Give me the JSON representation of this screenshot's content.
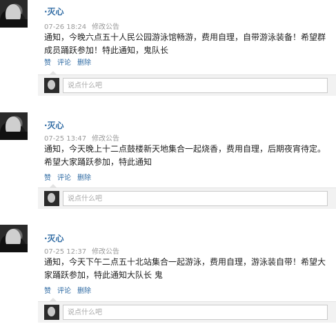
{
  "posts": [
    {
      "author": "·灭心",
      "time": "07-26 18:24",
      "edit_label": "修改公告",
      "content": "通知，今晚六点五十人民公园游泳馆畅游，费用自理，自带游泳装备！希望群成员踊跃参加！特此通知，鬼队长",
      "actions": [
        "赞",
        "评论",
        "删除"
      ],
      "comment_placeholder": "说点什么吧"
    },
    {
      "author": "·灭心",
      "time": "07-25 13:47",
      "edit_label": "修改公告",
      "content": "通知，今天晚上十二点鼓楼新天地集合一起烧香，费用自理，后期夜宵待定。希望大家踊跃参加，特此通知",
      "actions": [
        "赞",
        "评论",
        "删除"
      ],
      "comment_placeholder": "说点什么吧"
    },
    {
      "author": "·灭心",
      "time": "07-25 12:37",
      "edit_label": "修改公告",
      "content": "通知，今天下午二点五十北站集合一起游泳，费用自理，游泳装自带！希望大家踊跃参加，特此通知大队长 鬼",
      "actions": [
        "赞",
        "评论",
        "删除"
      ],
      "comment_placeholder": "说点什么吧"
    }
  ]
}
